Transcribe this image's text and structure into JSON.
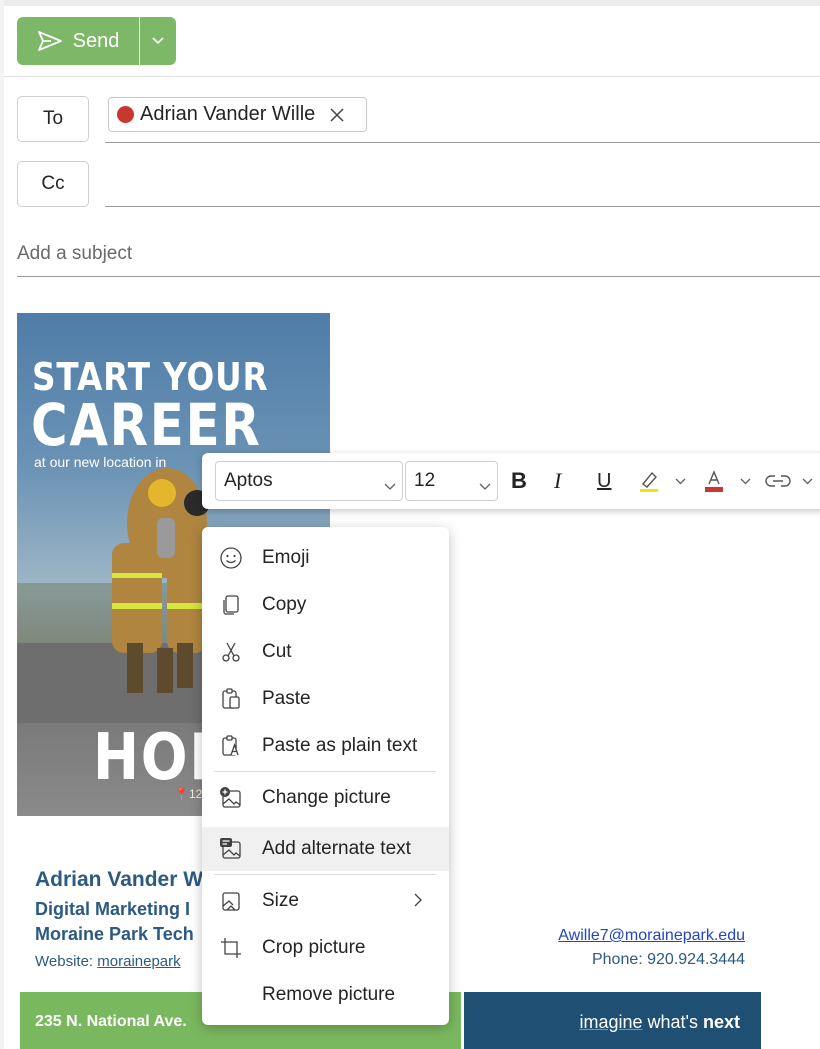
{
  "toolbar": {
    "send_label": "Send"
  },
  "recipients": {
    "to_label": "To",
    "cc_label": "Cc",
    "to_chip_name": "Adrian Vander Wille",
    "presence_color": "#c8382e"
  },
  "subject": {
    "placeholder": "Add a subject"
  },
  "poster": {
    "line1": "START YOUR",
    "line2": "CAREER",
    "line3": "at our new location in",
    "line4": "HOR",
    "pin_text": "📍12"
  },
  "format_bar": {
    "font_family": "Aptos",
    "font_size": "12",
    "bold": "B",
    "italic": "I",
    "underline": "U",
    "highlight_color": "#f2e600",
    "font_color": "#c8382e"
  },
  "context_menu": {
    "items": [
      {
        "label": "Emoji",
        "icon": "emoji-icon"
      },
      {
        "label": "Copy",
        "icon": "copy-icon"
      },
      {
        "label": "Cut",
        "icon": "cut-icon"
      },
      {
        "label": "Paste",
        "icon": "paste-icon"
      },
      {
        "label": "Paste as plain text",
        "icon": "paste-plain-text-icon"
      },
      {
        "label": "Change picture",
        "icon": "change-picture-icon"
      },
      {
        "label": "Add alternate text",
        "icon": "alt-text-icon"
      },
      {
        "label": "Size",
        "icon": "size-icon"
      },
      {
        "label": "Crop picture",
        "icon": "crop-icon"
      },
      {
        "label": "Remove picture",
        "icon": ""
      }
    ],
    "highlighted": "Add alternate text"
  },
  "signature": {
    "name": "Adrian Vander W",
    "title": "Digital Marketing I",
    "org": "Moraine Park Tech",
    "website_label": "Website:",
    "website_link": "morainepark",
    "email": "Awille7@morainepark.edu",
    "phone": "Phone: 920.924.3444",
    "address": "235 N. National Ave.",
    "tagline_1": "imagine",
    "tagline_2": " what's ",
    "tagline_3": "next",
    "green": "#7ab85f",
    "blue": "#1f4f72"
  }
}
